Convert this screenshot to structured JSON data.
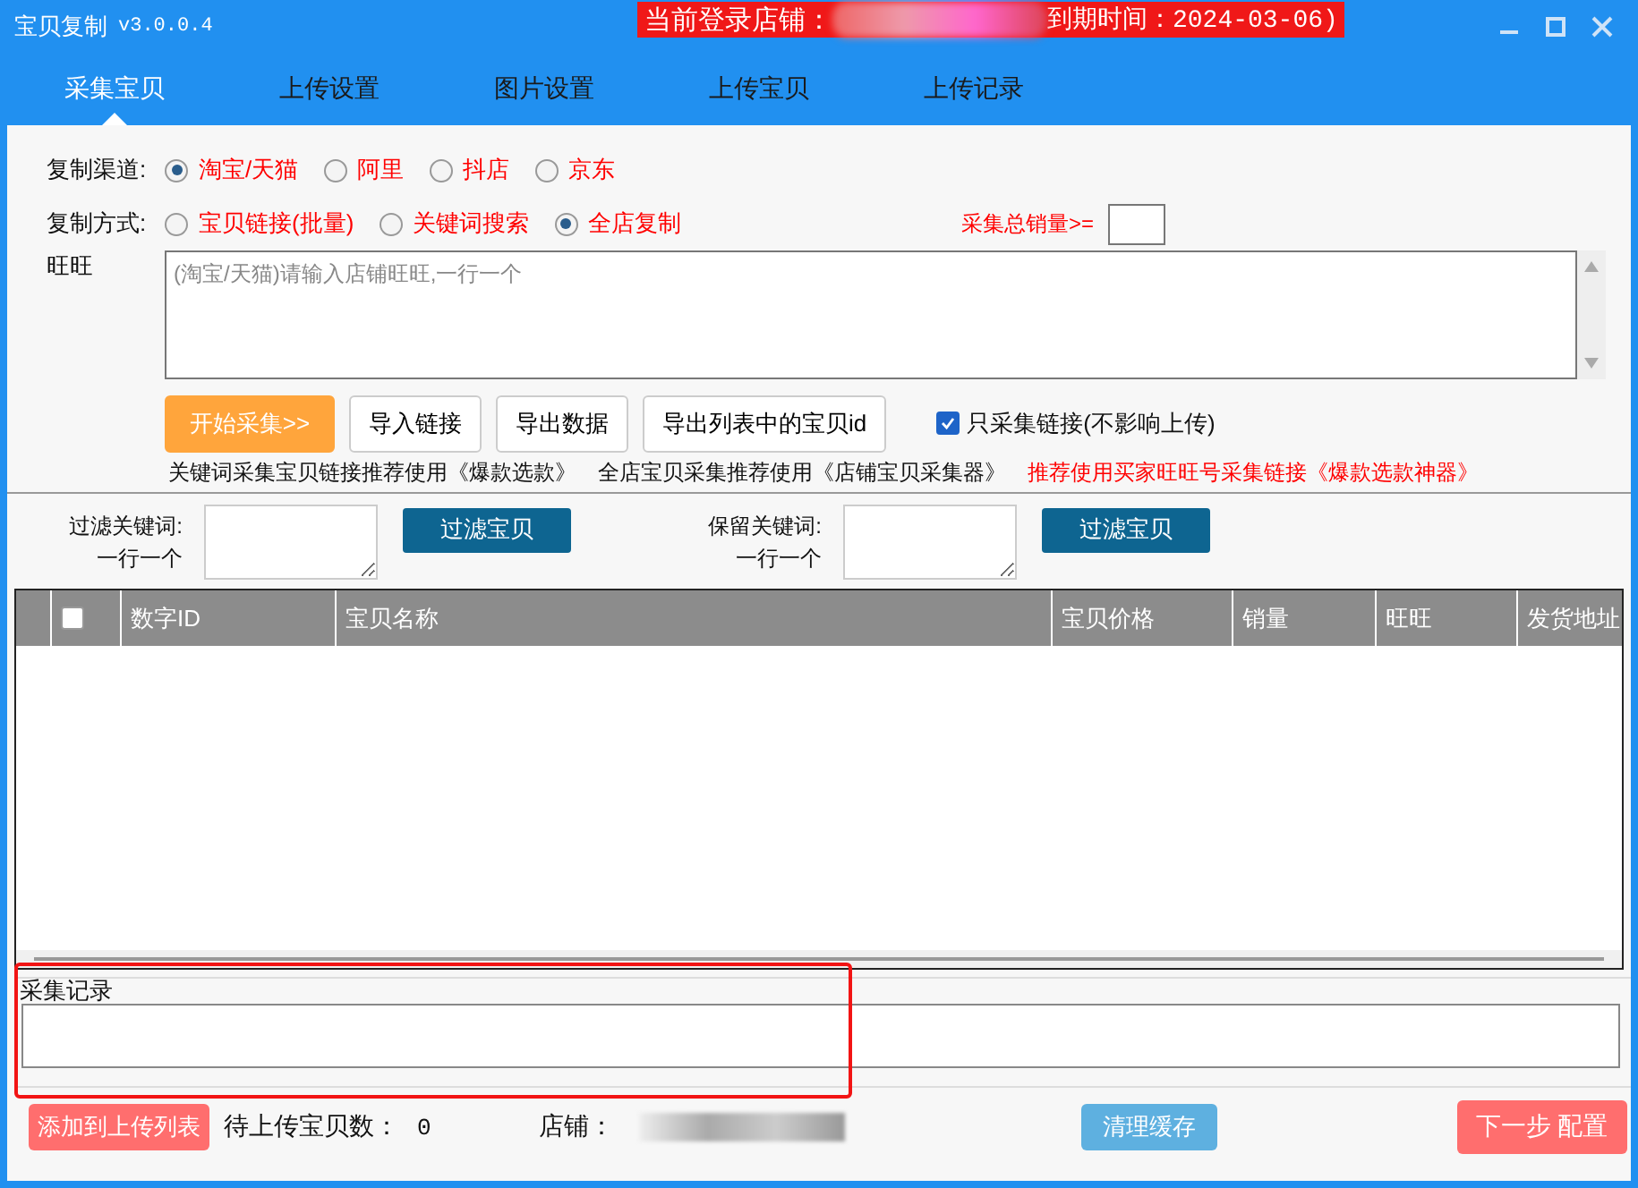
{
  "window": {
    "title": "宝贝复制",
    "version": "v3.0.0.4",
    "banner": {
      "label": "当前登录店铺：",
      "expiry": "到期时间：2024-03-06)"
    }
  },
  "tabs": [
    {
      "label": "采集宝贝",
      "selected": true
    },
    {
      "label": "上传设置",
      "selected": false
    },
    {
      "label": "图片设置",
      "selected": false
    },
    {
      "label": "上传宝贝",
      "selected": false
    },
    {
      "label": "上传记录",
      "selected": false
    }
  ],
  "channel": {
    "label": "复制渠道:",
    "options": [
      {
        "label": "淘宝/天猫",
        "selected": true
      },
      {
        "label": "阿里",
        "selected": false
      },
      {
        "label": "抖店",
        "selected": false
      },
      {
        "label": "京东",
        "selected": false
      }
    ]
  },
  "method": {
    "label": "复制方式:",
    "options": [
      {
        "label": "宝贝链接(批量)",
        "selected": false
      },
      {
        "label": "关键词搜索",
        "selected": false
      },
      {
        "label": "全店复制",
        "selected": true
      }
    ]
  },
  "min_sales": {
    "label": "采集总销量>="
  },
  "wangwang": {
    "label": "旺旺",
    "placeholder": "(淘宝/天猫)请输入店铺旺旺,一行一个"
  },
  "actions": [
    {
      "label": "开始采集>>",
      "kind": "primary"
    },
    {
      "label": "导入链接",
      "kind": "plain"
    },
    {
      "label": "导出数据",
      "kind": "plain"
    },
    {
      "label": "导出列表中的宝贝id",
      "kind": "plain"
    }
  ],
  "links_only": {
    "label": "只采集链接(不影响上传)",
    "checked": true
  },
  "hints": [
    {
      "text": "关键词采集宝贝链接推荐使用《爆款选款》",
      "kind": "normal"
    },
    {
      "text": "全店宝贝采集推荐使用《店铺宝贝采集器》",
      "kind": "normal"
    },
    {
      "text": "推荐使用买家旺旺号采集链接《爆款选款神器》",
      "kind": "warning"
    }
  ],
  "filters": [
    {
      "label": "过滤关键词:",
      "sub": "一行一个",
      "button": "过滤宝贝"
    },
    {
      "label": "保留关键词:",
      "sub": "一行一个",
      "button": "过滤宝贝"
    }
  ],
  "table": {
    "select_all": {
      "checked": false
    },
    "columns": [
      "数字ID",
      "宝贝名称",
      "宝贝价格",
      "销量",
      "旺旺",
      "发货地址"
    ]
  },
  "log": {
    "title": "采集记录"
  },
  "footer": {
    "add_button": "添加到上传列表",
    "pending_label": "待上传宝贝数：",
    "pending_count": "0",
    "store_label": "店铺：",
    "clear_button": "清理缓存",
    "next_button": "下一步 配置"
  }
}
